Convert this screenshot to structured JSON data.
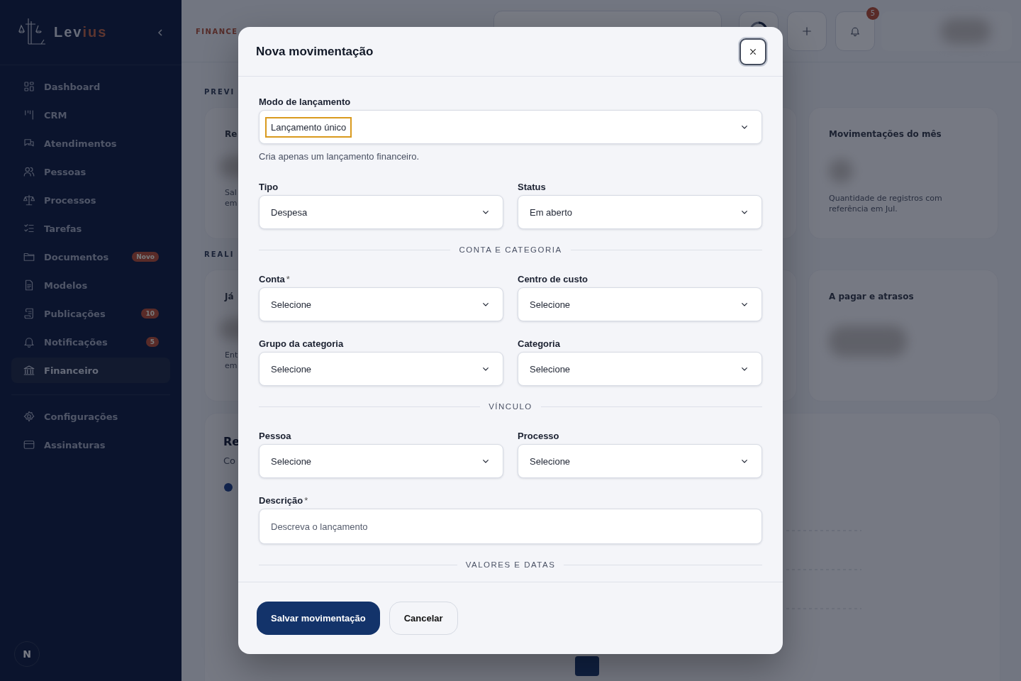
{
  "sidebar": {
    "brand_parts": [
      "Lev",
      "ius"
    ],
    "items": [
      {
        "label": "Dashboard",
        "selected": false
      },
      {
        "label": "CRM",
        "selected": false
      },
      {
        "label": "Atendimentos",
        "selected": false
      },
      {
        "label": "Pessoas",
        "selected": false
      },
      {
        "label": "Processos",
        "selected": false
      },
      {
        "label": "Tarefas",
        "selected": false
      },
      {
        "label": "Documentos",
        "selected": false,
        "badge": "Novo"
      },
      {
        "label": "Modelos",
        "selected": false
      },
      {
        "label": "Publicações",
        "selected": false,
        "badge": "10"
      },
      {
        "label": "Notificações",
        "selected": false,
        "badge": "5"
      },
      {
        "label": "Financeiro",
        "selected": true
      }
    ],
    "footer_items": [
      {
        "label": "Configurações",
        "selected": false
      },
      {
        "label": "Assinaturas",
        "selected": false
      }
    ],
    "user_initial": "N"
  },
  "header": {
    "breadcrumb": "FINANCE",
    "notification_count": "5"
  },
  "sections": [
    {
      "label": "PREVI",
      "left_card": {
        "title": "Re",
        "lines": [
          "Sal",
          "em"
        ]
      },
      "right_card": {
        "title": "Movimentações do mês",
        "desc": "Quantidade de registros com referência em Jul."
      }
    },
    {
      "label": "REALI",
      "left_card": {
        "title": "Já",
        "lines": [
          "Ent",
          "em"
        ]
      },
      "right_card": {
        "title": "A pagar e atrasos"
      }
    }
  ],
  "report_card": {
    "title": "Re",
    "subtitle": "Co"
  },
  "modal": {
    "title": "Nova movimentação",
    "fields": [
      {
        "kind": "select",
        "label": "Modo de lançamento",
        "value": "Lançamento único",
        "focused": true
      },
      {
        "kind": "help",
        "text": "Cria apenas um lançamento financeiro."
      },
      {
        "kind": "pair",
        "items": [
          {
            "label": "Tipo",
            "value": "Despesa"
          },
          {
            "label": "Status",
            "value": "Em aberto"
          }
        ]
      },
      {
        "kind": "section",
        "text": "CONTA E CATEGORIA"
      },
      {
        "kind": "pair",
        "items": [
          {
            "label": "Conta",
            "mark": "*",
            "value": "Selecione"
          },
          {
            "label": "Centro de custo",
            "value": "Selecione"
          }
        ]
      },
      {
        "kind": "pair",
        "items": [
          {
            "label": "Grupo da categoria",
            "value": "Selecione"
          },
          {
            "label": "Categoria",
            "value": "Selecione"
          }
        ]
      },
      {
        "kind": "section",
        "text": "VÍNCULO"
      },
      {
        "kind": "pair",
        "items": [
          {
            "label": "Pessoa",
            "value": "Selecione"
          },
          {
            "label": "Processo",
            "value": "Selecione"
          }
        ]
      },
      {
        "kind": "input",
        "label": "Descrição",
        "mark": "*",
        "placeholder": "Descreva o lançamento"
      },
      {
        "kind": "section",
        "text": "VALORES E DATAS"
      }
    ],
    "buttons": [
      {
        "label": "Salvar movimentação",
        "kind": "primary"
      },
      {
        "label": "Cancelar",
        "kind": "secondary"
      }
    ]
  }
}
